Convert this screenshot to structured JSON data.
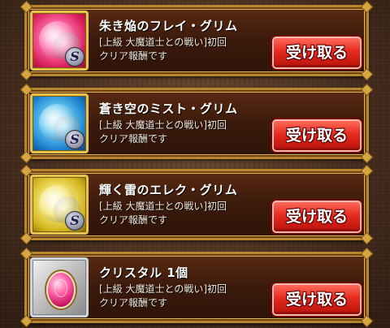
{
  "rewards": [
    {
      "title": "朱き焔のフレイ・グリム",
      "description": "[上級 大魔道士との戦い]初回クリア報酬です",
      "claim_label": "受け取る",
      "icon": "fire-monster-icon",
      "element": "fire",
      "rank": "S"
    },
    {
      "title": "蒼き空のミスト・グリム",
      "description": "[上級 大魔道士との戦い]初回クリア報酬です",
      "claim_label": "受け取る",
      "icon": "water-monster-icon",
      "element": "water",
      "rank": "S"
    },
    {
      "title": "輝く雷のエレク・グリム",
      "description": "[上級 大魔道士との戦い]初回クリア報酬です",
      "claim_label": "受け取る",
      "icon": "light-monster-icon",
      "element": "light",
      "rank": "S"
    },
    {
      "title": "クリスタル 1個",
      "description": "[上級 大魔道士との戦い]初回クリア報酬です",
      "claim_label": "受け取る",
      "icon": "crystal-gem-icon",
      "element": "crystal"
    }
  ],
  "colors": {
    "panel_border": "#b8862e",
    "claim_button": "#e62a1e",
    "fire": "#d81f5a",
    "water": "#1a7fcc",
    "light": "#d0b21c",
    "crystal": "#ff5aa0"
  }
}
